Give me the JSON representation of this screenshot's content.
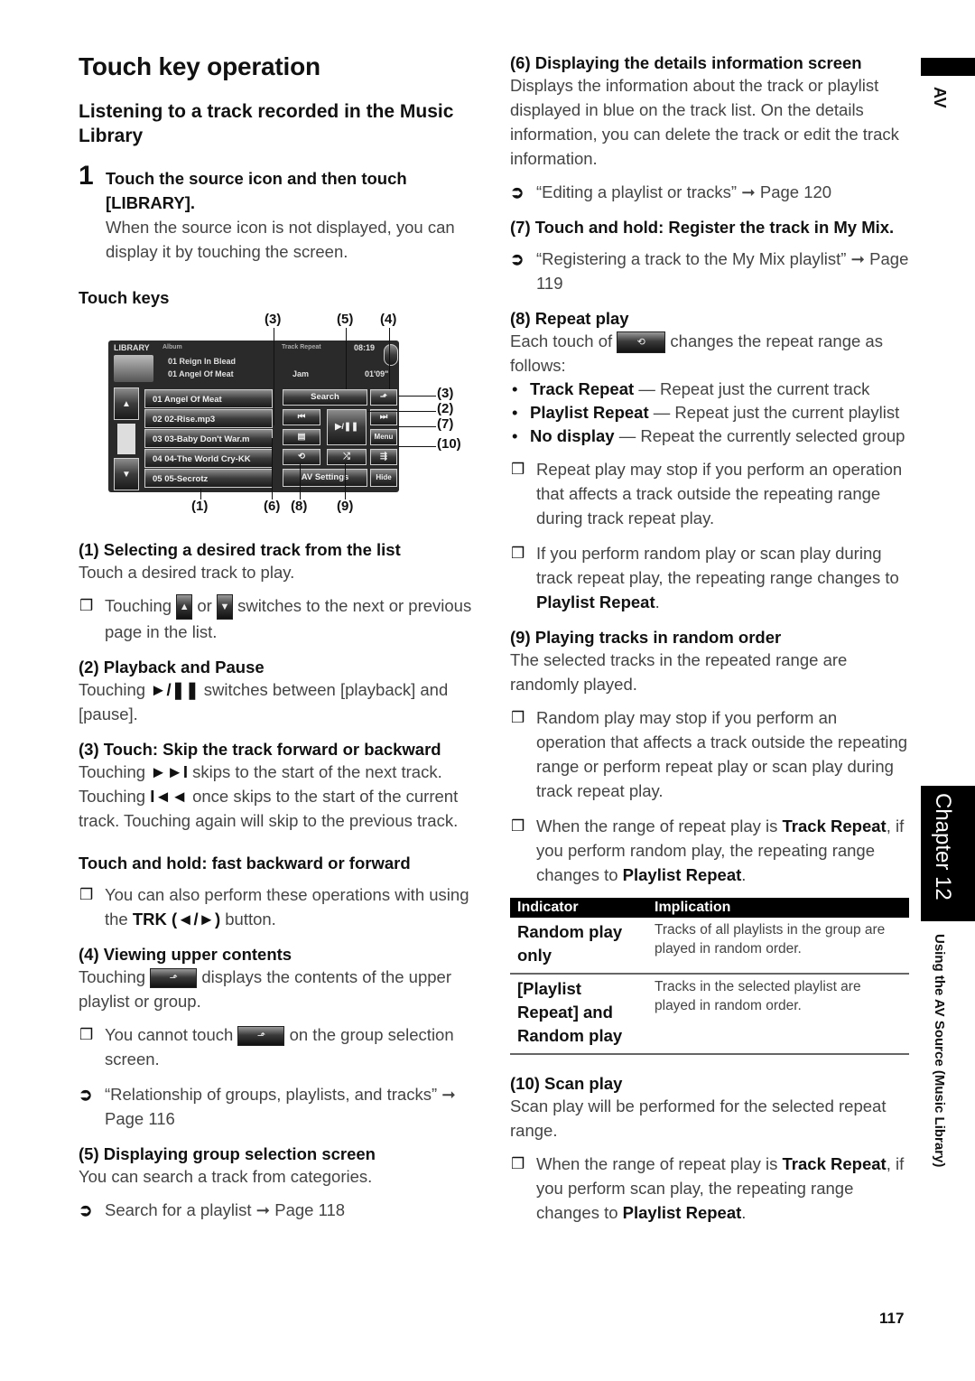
{
  "title": "Touch key operation",
  "subtitle": "Listening to a track recorded in the Music Library",
  "step1": {
    "number": "1",
    "title": "Touch the source icon and then touch [LIBRARY].",
    "body": "When the source icon is not displayed, you can display it by touching the screen."
  },
  "touch_keys_heading": "Touch keys",
  "figure": {
    "callouts": {
      "c3_top": "(3)",
      "c5": "(5)",
      "c4": "(4)",
      "c3_right": "(3)",
      "c2": "(2)",
      "c7": "(7)",
      "c10": "(10)",
      "c1": "(1)",
      "c6": "(6)",
      "c8": "(8)",
      "c9": "(9)"
    },
    "screen": {
      "source": "LIBRARY",
      "source_sub": "Album",
      "mode_labels": "Track   Repeat",
      "clock": "08:19",
      "now_album": "01 Reign In Blead",
      "now_track": "01 Angel Of Meat",
      "artist": "Jam",
      "elapsed": "01'09\"",
      "tracks": [
        "01 Angel Of Meat",
        "02 02-Rise.mp3",
        "03 03-Baby Don't War.m",
        "04 04-The World Cry-KK",
        "05 05-Secrotz"
      ],
      "buttons": {
        "search": "Search",
        "up": "⬏",
        "prev": "⏮",
        "play_pause": "▶/❚❚",
        "next": "⏭",
        "details": "▤",
        "menu": "Menu",
        "repeat": "⟲",
        "random": "⤮",
        "scan": "⇶",
        "av_settings": "AV Settings",
        "hide": "Hide"
      }
    }
  },
  "left_sections": {
    "s1": {
      "heading": "(1) Selecting a desired track from the list",
      "body": "Touch a desired track to play.",
      "note_pre": "Touching",
      "note_mid": "or",
      "note_post": "switches to the next or previous page in the list."
    },
    "s2": {
      "heading": "(2) Playback and Pause",
      "body_pre": "Touching",
      "symbol": "►/❚❚",
      "body_post": "switches between [playback] and [pause]."
    },
    "s3": {
      "heading": "(3) Touch: Skip the track forward or backward",
      "line1_pre": "Touching",
      "line1_sym": "►►I",
      "line1_post": "skips to the start of the next track.",
      "line2_pre": "Touching",
      "line2_sym": "I◄◄",
      "line2_post": "once skips to the start of the current track. Touching again will skip to the previous track."
    },
    "hold": {
      "heading": "Touch and hold: fast backward or forward",
      "note_pre": "You can also perform these operations with using the",
      "note_bold": "TRK (◄/►)",
      "note_post": "button."
    },
    "s4": {
      "heading": "(4) Viewing upper contents",
      "body_pre": "Touching",
      "body_post": "displays the contents of the upper playlist or group.",
      "note_pre": "You cannot touch",
      "note_post": "on the group selection screen.",
      "ref": "“Relationship of groups, playlists, and tracks” ➞ Page 116"
    },
    "s5": {
      "heading": "(5) Displaying group selection screen",
      "body": "You can search a track from categories.",
      "ref": "Search for a playlist ➞ Page 118"
    }
  },
  "right_sections": {
    "s6": {
      "heading": "(6) Displaying the details information screen",
      "body": "Displays the information about the track or playlist displayed in blue on the track list. On the details information, you can delete the track or edit the track information.",
      "ref": "“Editing a playlist or tracks” ➞ Page 120"
    },
    "s7": {
      "heading": "(7) Touch and hold: Register the track in My Mix.",
      "ref": "“Registering a track to the My Mix playlist” ➞ Page 119"
    },
    "s8": {
      "heading": "(8) Repeat play",
      "body_pre": "Each touch of",
      "body_post": "changes the repeat range as follows:",
      "bullets": [
        {
          "bold": "Track Repeat",
          "text": " — Repeat just the current track"
        },
        {
          "bold": "Playlist Repeat",
          "text": " — Repeat just the current playlist"
        },
        {
          "bold": "No display",
          "text": " — Repeat the currently selected group"
        }
      ],
      "note1": "Repeat play may stop if you perform an operation that affects a track outside the repeating range during track repeat play.",
      "note2_pre": "If you perform random play or scan play during track repeat play, the repeating range changes to",
      "note2_bold": "Playlist Repeat",
      "note2_post": "."
    },
    "s9": {
      "heading": "(9) Playing tracks in random order",
      "body": "The selected tracks in the repeated range are randomly played.",
      "note1": "Random play may stop if you perform an operation that affects a track outside the repeating range or perform repeat play or scan play during track repeat play.",
      "note2_pre": "When the range of repeat play is",
      "note2_bold1": "Track Repeat",
      "note2_mid": ", if you perform random play, the repeating range changes to",
      "note2_bold2": "Playlist Repeat",
      "note2_post": "."
    },
    "table": {
      "headers": [
        "Indicator",
        "Implication"
      ],
      "rows": [
        {
          "indicator": "Random play only",
          "implication": "Tracks of all playlists in the group are played in random order."
        },
        {
          "indicator": "[Playlist Repeat] and Random play",
          "implication": "Tracks in the selected playlist are played in random order."
        }
      ]
    },
    "s10": {
      "heading": "(10) Scan play",
      "body": "Scan play will be performed for the selected repeat range.",
      "note_pre": "When the range of repeat play is",
      "note_bold1": "Track Repeat",
      "note_mid": ", if you perform scan play, the repeating range changes to",
      "note_bold2": "Playlist Repeat",
      "note_post": "."
    }
  },
  "side": {
    "av_tab": "AV",
    "chapter_tab": "Chapter 12",
    "section_title": "Using the AV Source (Music Library)"
  },
  "page_number": "117",
  "glyphs": {
    "note_mark": "❒",
    "ref_mark": "➲",
    "bullet": "•",
    "up_arrow_icon": "▲",
    "down_arrow_icon": "▼"
  }
}
